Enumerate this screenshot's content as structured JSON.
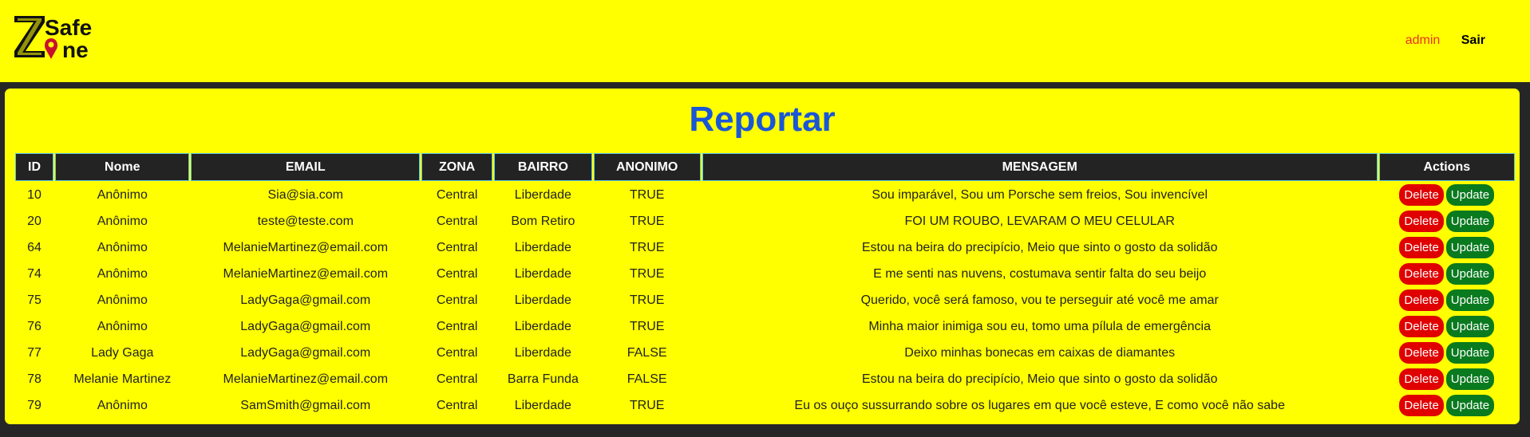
{
  "header": {
    "logo_text": "Z Safe Zone",
    "user": "admin",
    "logout_label": "Sair"
  },
  "page": {
    "title": "Reportar"
  },
  "table": {
    "columns": [
      "ID",
      "Nome",
      "EMAIL",
      "ZONA",
      "BAIRRO",
      "ANONIMO",
      "MENSAGEM",
      "Actions"
    ],
    "delete_label": "Delete",
    "update_label": "Update",
    "rows": [
      {
        "id": "10",
        "nome": "Anônimo",
        "email": "Sia@sia.com",
        "zona": "Central",
        "bairro": "Liberdade",
        "anonimo": "TRUE",
        "mensagem": "Sou imparável, Sou um Porsche sem freios, Sou invencível"
      },
      {
        "id": "20",
        "nome": "Anônimo",
        "email": "teste@teste.com",
        "zona": "Central",
        "bairro": "Bom Retiro",
        "anonimo": "TRUE",
        "mensagem": "FOI UM ROUBO, LEVARAM O MEU CELULAR"
      },
      {
        "id": "64",
        "nome": "Anônimo",
        "email": "MelanieMartinez@email.com",
        "zona": "Central",
        "bairro": "Liberdade",
        "anonimo": "TRUE",
        "mensagem": "Estou na beira do precipício, Meio que sinto o gosto da solidão"
      },
      {
        "id": "74",
        "nome": "Anônimo",
        "email": "MelanieMartinez@email.com",
        "zona": "Central",
        "bairro": "Liberdade",
        "anonimo": "TRUE",
        "mensagem": "E me senti nas nuvens, costumava sentir falta do seu beijo"
      },
      {
        "id": "75",
        "nome": "Anônimo",
        "email": "LadyGaga@gmail.com",
        "zona": "Central",
        "bairro": "Liberdade",
        "anonimo": "TRUE",
        "mensagem": "Querido, você será famoso, vou te perseguir até você me amar"
      },
      {
        "id": "76",
        "nome": "Anônimo",
        "email": "LadyGaga@gmail.com",
        "zona": "Central",
        "bairro": "Liberdade",
        "anonimo": "TRUE",
        "mensagem": "Minha maior inimiga sou eu, tomo uma pílula de emergência"
      },
      {
        "id": "77",
        "nome": "Lady Gaga",
        "email": "LadyGaga@gmail.com",
        "zona": "Central",
        "bairro": "Liberdade",
        "anonimo": "FALSE",
        "mensagem": "Deixo minhas bonecas em caixas de diamantes"
      },
      {
        "id": "78",
        "nome": "Melanie Martinez",
        "email": "MelanieMartinez@email.com",
        "zona": "Central",
        "bairro": "Barra Funda",
        "anonimo": "FALSE",
        "mensagem": "Estou na beira do precipício, Meio que sinto o gosto da solidão"
      },
      {
        "id": "79",
        "nome": "Anônimo",
        "email": "SamSmith@gmail.com",
        "zona": "Central",
        "bairro": "Liberdade",
        "anonimo": "TRUE",
        "mensagem": "Eu os ouço sussurrando sobre os lugares em que você esteve, E como você não sabe"
      }
    ]
  }
}
